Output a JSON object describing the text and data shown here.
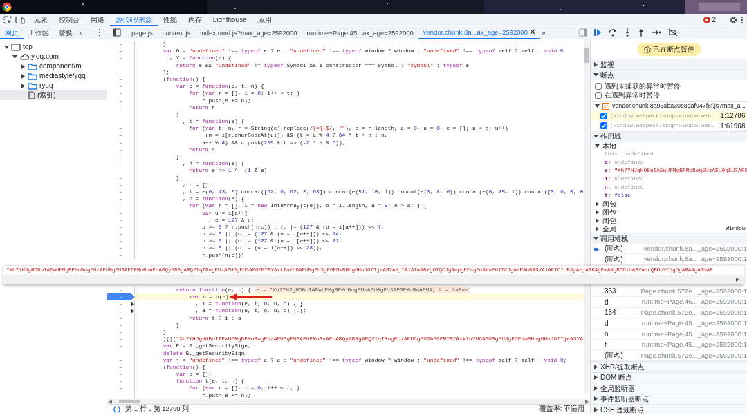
{
  "toolbar": {
    "tabs": [
      {
        "label": "元素",
        "selected": false
      },
      {
        "label": "控制台",
        "selected": false
      },
      {
        "label": "网络",
        "selected": false
      },
      {
        "label": "源代码/来源",
        "selected": true
      },
      {
        "label": "性能",
        "selected": false
      },
      {
        "label": "内存",
        "selected": false
      },
      {
        "label": "Lighthouse",
        "selected": false
      },
      {
        "label": "应用",
        "selected": false
      }
    ],
    "error_count": "2"
  },
  "navigator": {
    "tabs": [
      {
        "label": "网页",
        "selected": true
      },
      {
        "label": "工作区",
        "selected": false
      },
      {
        "label": "替换",
        "selected": false
      }
    ],
    "more": "»",
    "tree": [
      {
        "label": "top",
        "kind": "frame",
        "expanded": true,
        "selected": false,
        "children": [
          {
            "label": "y.qq.com",
            "kind": "domain",
            "expanded": true,
            "selected": false,
            "children": [
              {
                "label": "component/m",
                "kind": "folder",
                "expanded": false,
                "selected": false
              },
              {
                "label": "mediastyle/yqq",
                "kind": "folder",
                "expanded": false,
                "selected": false
              },
              {
                "label": "ryqq",
                "kind": "folder",
                "expanded": false,
                "selected": false
              },
              {
                "label": "(索引)",
                "kind": "file",
                "selected": true
              }
            ]
          }
        ]
      }
    ]
  },
  "editor": {
    "tabs": [
      {
        "label": "page.js",
        "selected": false
      },
      {
        "label": "content.js",
        "selected": false
      },
      {
        "label": "index.umd.js?max_age=2592000",
        "selected": false
      },
      {
        "label": "runtime~Page.45...ax_age=2592000",
        "selected": false
      },
      {
        "label": "vendor.chunk.8a...ax_age=2592000",
        "selected": true
      }
    ],
    "more": "»",
    "upper_lines": [
      {
        "kind": "plain",
        "gutter": "-",
        "seg": [
          "        }"
        ]
      },
      {
        "kind": "plain",
        "gutter": "-",
        "seg": [
          {
            "kw": "        var"
          },
          " G = ",
          {
            "str": "\"undefined\""
          },
          " !== ",
          {
            "kw": "typeof"
          },
          " e ? e : ",
          {
            "str": "\"undefined\""
          },
          " !== ",
          {
            "kw": "typeof"
          },
          " window ? window : ",
          {
            "str": "\"undefined\""
          },
          " !== ",
          {
            "kw": "typeof"
          },
          " self ? self : ",
          {
            "kw": "void"
          },
          {
            "num": " 0"
          }
        ]
      },
      {
        "kind": "plain",
        "gutter": "-",
        "seg": [
          "          , Y = ",
          {
            "kw": "function"
          },
          "(e) {"
        ]
      },
      {
        "kind": "plain",
        "gutter": "-",
        "seg": [
          {
            "kw": "            return"
          },
          " e && ",
          {
            "str": "\"undefined\""
          },
          " != ",
          {
            "kw": "typeof"
          },
          " Symbol && e.constructor === Symbol ? ",
          {
            "str": "\"symbol\""
          },
          " : ",
          {
            "kw": "typeof"
          },
          " e"
        ]
      },
      {
        "kind": "plain",
        "gutter": "-",
        "seg": [
          "        };"
        ]
      },
      {
        "kind": "plain",
        "gutter": "-",
        "seg": [
          "        (",
          {
            "kw": "function"
          },
          "() {"
        ]
      },
      {
        "kind": "plain",
        "gutter": "-",
        "seg": [
          {
            "kw": "            var"
          },
          " e = ",
          {
            "kw": "function"
          },
          "(e, t, n) {"
        ]
      },
      {
        "kind": "plain",
        "gutter": "-",
        "seg": [
          {
            "kw": "                for"
          },
          " (",
          {
            "kw": "var"
          },
          " r = [], i = ",
          {
            "num": "0"
          },
          "; i++ < t; )"
        ]
      },
      {
        "kind": "plain",
        "gutter": "-",
        "seg": [
          "                    r.push(e += n);"
        ]
      },
      {
        "kind": "plain",
        "gutter": "-",
        "seg": [
          {
            "kw": "                return"
          },
          " r"
        ]
      },
      {
        "kind": "plain",
        "gutter": "-",
        "seg": [
          "            }"
        ]
      },
      {
        "kind": "plain",
        "gutter": "-",
        "seg": [
          "              , t = ",
          {
            "kw": "function"
          },
          "(e) {"
        ]
      },
      {
        "kind": "plain",
        "gutter": "-",
        "seg": [
          {
            "kw": "                for"
          },
          " (",
          {
            "kw": "var"
          },
          " t, n, r = String(e).replace(",
          {
            "str": "/[=]+$/"
          },
          ", ",
          {
            "str": "\"\""
          },
          "), o = r.length, a = ",
          {
            "num": "0"
          },
          ", u = ",
          {
            "num": "0"
          },
          ", c = []; u < o; u++)"
        ]
      },
      {
        "kind": "plain",
        "gutter": "-",
        "seg": [
          "                    ~(n = i[r.charCodeAt(u)]) && (t = a % ",
          {
            "num": "4"
          },
          " ? ",
          {
            "num": "64"
          },
          " * t + n : n,"
        ]
      },
      {
        "kind": "plain",
        "gutter": "-",
        "seg": [
          "                    a++ % ",
          {
            "num": "4"
          },
          ") && c.push(",
          {
            "num": "255"
          },
          " & t >> (-",
          {
            "num": "2"
          },
          " * a & ",
          {
            "num": "6"
          },
          "));"
        ]
      },
      {
        "kind": "plain",
        "gutter": "-",
        "seg": [
          {
            "kw": "                return"
          },
          " c"
        ]
      },
      {
        "kind": "plain",
        "gutter": "-",
        "seg": [
          "            }"
        ]
      },
      {
        "kind": "plain",
        "gutter": "-",
        "seg": [
          "              , n = ",
          {
            "kw": "function"
          },
          "(e) {"
        ]
      },
      {
        "kind": "plain",
        "gutter": "-",
        "seg": [
          {
            "kw": "                return"
          },
          " e >> ",
          {
            "num": "1"
          },
          " ^ -(",
          {
            "num": "1"
          },
          " & e)"
        ]
      },
      {
        "kind": "plain",
        "gutter": "-",
        "seg": [
          "            }"
        ]
      },
      {
        "kind": "plain",
        "gutter": "-",
        "seg": [
          "              , r = []"
        ]
      },
      {
        "kind": "plain",
        "gutter": "-",
        "seg": [
          "              , i = e(",
          {
            "num": "0"
          },
          ", ",
          {
            "num": "43"
          },
          ", ",
          {
            "num": "0"
          },
          ").concat([",
          {
            "num": "62"
          },
          ", ",
          {
            "num": "0"
          },
          ", ",
          {
            "num": "62"
          },
          ", ",
          {
            "num": "0"
          },
          ", ",
          {
            "num": "63"
          },
          "]).concat(e(",
          {
            "num": "51"
          },
          ", ",
          {
            "num": "10"
          },
          ", ",
          {
            "num": "1"
          },
          ")).concat(e(",
          {
            "num": "0"
          },
          ", ",
          {
            "num": "8"
          },
          ", ",
          {
            "num": "0"
          },
          ")).concat(e(",
          {
            "num": "0"
          },
          ", ",
          {
            "num": "25"
          },
          ", ",
          {
            "num": "1"
          },
          ")).concat([",
          {
            "num": "0"
          },
          ", ",
          {
            "num": "0"
          },
          ", ",
          {
            "num": "0"
          },
          ", ",
          {
            "num": "0"
          }
        ]
      },
      {
        "kind": "plain",
        "gutter": "-",
        "seg": [
          "              , o = ",
          {
            "kw": "function"
          },
          "(e) {"
        ]
      },
      {
        "kind": "plain",
        "gutter": "-",
        "seg": [
          {
            "kw": "                for"
          },
          " (",
          {
            "kw": "var"
          },
          " r = [], i = ",
          {
            "kw": "new"
          },
          " Int8Array(t(e)), o = i.length, a = ",
          {
            "num": "0"
          },
          "; o > a; ) {"
        ]
      },
      {
        "kind": "plain",
        "gutter": "-",
        "seg": [
          {
            "kw": "                    var"
          },
          " u = i[a++]"
        ]
      },
      {
        "kind": "plain",
        "gutter": "-",
        "seg": [
          "                      , c = ",
          {
            "num": "127"
          },
          " & u;"
        ]
      },
      {
        "kind": "plain",
        "gutter": "-",
        "seg": [
          "                    u >= ",
          {
            "num": "0"
          },
          " ? r.push(n(c)) : (c |= (",
          {
            "num": "127"
          },
          " & (u = i[a++])) << ",
          {
            "num": "7"
          },
          ","
        ]
      },
      {
        "kind": "plain",
        "gutter": "-",
        "seg": [
          "                    u >= ",
          {
            "num": "0"
          },
          " || (c |= (",
          {
            "num": "127"
          },
          " & (u = i[a++])) << ",
          {
            "num": "14"
          },
          ","
        ]
      },
      {
        "kind": "plain",
        "gutter": "-",
        "seg": [
          "                    u >= ",
          {
            "num": "0"
          },
          " || (c |= (",
          {
            "num": "127"
          },
          " & (u = i[a++])) << ",
          {
            "num": "21"
          },
          ","
        ]
      },
      {
        "kind": "plain",
        "gutter": "-",
        "seg": [
          "                    u >= ",
          {
            "num": "0"
          },
          " || (c |= (u = i[a++]) << ",
          {
            "num": "28"
          },
          ")),"
        ]
      },
      {
        "kind": "plain",
        "gutter": "-",
        "seg": [
          "                    r.push(n(c)))"
        ]
      }
    ],
    "lower_lines": [
      {
        "kind": "plain",
        "gutter": "-",
        "seg": [
          {
            "kw": "            return"
          },
          {
            "kw": " function"
          },
          "(e, t) {"
        ],
        "inline_value": "e = \"Xh7YHJgHOBoIAEwUFMgBFMoBogEUzAEU0gEU3AFGFMoBnAEUA, t = false"
      },
      {
        "kind": "paused",
        "gutter": "-",
        "seg": [
          {
            "kw": "                var"
          },
          " n = o(e)"
        ]
      },
      {
        "kind": "folded",
        "gutter": "-",
        "seg": [
          "                  , i = ",
          {
            "kw": "function"
          },
          "(e, t, o, u, c) {…}"
        ]
      },
      {
        "kind": "folded",
        "gutter": "-",
        "seg": [
          "                  , a = ",
          {
            "kw": "function"
          },
          "(e, t, o, u, c) {…};"
        ]
      },
      {
        "kind": "plain",
        "gutter": "-",
        "seg": [
          {
            "kw": "                return"
          },
          " t ? i : a"
        ]
      },
      {
        "kind": "plain",
        "gutter": "-",
        "seg": [
          "            }"
        ]
      },
      {
        "kind": "plain",
        "gutter": "-",
        "seg": [
          "        }"
        ]
      },
      {
        "kind": "plain",
        "gutter": "-",
        "seg": [
          "        )()(",
          {
            "str": "\"Xh7YHJgHOBoIAEwUFMgBFMoBogEUzAEU0gEU3AFGFMoBnAEUABQyGBSgARQ2IqIBogEUzAEU6gEU3AFGFMYBYAxkInYU6AEU0gEU3gFOFNwBHhgUHoJOfTjeASYA"
          }
        ]
      },
      {
        "kind": "plain",
        "gutter": "-",
        "seg": [
          {
            "kw": "        var"
          },
          " P = G._getSecuritySign;"
        ]
      },
      {
        "kind": "plain",
        "gutter": "-",
        "seg": [
          {
            "kw": "        delete"
          },
          " G._getSecuritySign;"
        ]
      },
      {
        "kind": "plain",
        "gutter": "-",
        "seg": [
          {
            "kw": "        var"
          },
          " j = ",
          {
            "str": "\"undefined\""
          },
          " !== ",
          {
            "kw": "typeof"
          },
          " e ? e : ",
          {
            "str": "\"undefined\""
          },
          " !== ",
          {
            "kw": "typeof"
          },
          " window ? window : ",
          {
            "str": "\"undefined\""
          },
          " !== ",
          {
            "kw": "typeof"
          },
          " self ? self : ",
          {
            "kw": "void"
          },
          {
            "num": " 0"
          },
          ";"
        ]
      },
      {
        "kind": "plain",
        "gutter": "-",
        "seg": [
          "        (",
          {
            "kw": "function"
          },
          "() {"
        ]
      },
      {
        "kind": "plain",
        "gutter": "-",
        "seg": [
          {
            "kw": "            var"
          },
          " e = [];"
        ]
      },
      {
        "kind": "plain",
        "gutter": "-",
        "seg": [
          {
            "kw": "            function"
          },
          " t(e, t, n) {"
        ]
      },
      {
        "kind": "plain",
        "gutter": "-",
        "seg": [
          {
            "kw": "                for"
          },
          " (",
          {
            "kw": "var"
          },
          " r = [], i = ",
          {
            "num": "0"
          },
          "; i++ < t; )"
        ]
      },
      {
        "kind": "plain",
        "gutter": "-",
        "seg": [
          "                    r.push(e += n);"
        ]
      }
    ],
    "tooltip": "\"Xh7YHJgHOBoIAEwUFMgBFMoBogEUzAEU0gEU3AFGFMoBnAEUABQyGBSgARQ2IqIBogEUzAEU6gEU3AFGFMYBYAxkInYU6AEU0gEU3gFOFNwBHhgUHoJOfTjeASYAHjIAiAImABYgOIQCJgAepgECsgEmAHoEOIICJgAeFAb0ASYA1AEIOIoBJgAejAIK4gEmANgBDDiUASYAHrQBDoYCJgDgARA4gAImAE"
  },
  "status_bar": {
    "position": "第 1 行，第 12790 列",
    "coverage": "覆盖率: 不适用"
  },
  "debugger": {
    "paused_message": "已在断点暂停",
    "watch": {
      "title": "监视",
      "expanded": false
    },
    "breakpoints": {
      "title": "断点",
      "expanded": true,
      "options": [
        {
          "label": "遇到未捕获的异常时暂停",
          "checked": false
        },
        {
          "label": "在遇到异常时暂停",
          "checked": false
        }
      ],
      "file": {
        "name": "vendor.chunk.8a93aba30e8daf947f8f.js?max_a...",
        "expanded": true
      },
      "items": [
        {
          "code": "(window.webpackJsonp=window.web…",
          "location": "1:12786",
          "checked": true,
          "selected": true
        },
        {
          "code": "(window.webpackJsonp=window.web…",
          "location": "1:61908",
          "checked": true,
          "selected": false
        }
      ]
    },
    "scope": {
      "title": "作用域",
      "expanded": true,
      "groups": [
        {
          "label": "本地",
          "expanded": true,
          "variables": [
            {
              "name": "this:",
              "value": "undefined",
              "kind": "undefined",
              "own": false
            },
            {
              "name": "a:",
              "value": "undefined",
              "kind": "undefined",
              "own": true
            },
            {
              "name": "e:",
              "value": "\"Xh7YHJgHOBoIAEwUFMgBFMoBogEUzAEU0gEU3AFG",
              "kind": "string",
              "own": true
            },
            {
              "name": "i:",
              "value": "undefined",
              "kind": "undefined",
              "own": true
            },
            {
              "name": "n:",
              "value": "undefined",
              "kind": "undefined",
              "own": true
            },
            {
              "name": "t:",
              "value": "false",
              "kind": "boolean",
              "own": true
            }
          ]
        },
        {
          "label": "闭包",
          "expanded": false
        },
        {
          "label": "闭包",
          "expanded": false
        },
        {
          "label": "闭包",
          "expanded": false
        },
        {
          "label": "全局",
          "expanded": false,
          "value": "Window"
        }
      ]
    },
    "call_stack": {
      "title": "调用堆栈",
      "expanded": true,
      "frames": [
        {
          "name": "(匿名)",
          "location": "vendor.chunk.8a..._age=2592000:1",
          "selected": true
        },
        {
          "name": "(匿名)",
          "location": "vendor.chunk.8a..._age=2592000:1",
          "selected": false
        },
        {
          "name": "363",
          "location": "Page.chunk.572e..._age=2592000:1",
          "selected": false
        },
        {
          "name": "d",
          "location": "runtime~Page.45..._age=2592000:1",
          "selected": false
        },
        {
          "name": "154",
          "location": "Page.chunk.572e..._age=2592000:1",
          "selected": false
        },
        {
          "name": "d",
          "location": "runtime~Page.45..._age=2592000:1",
          "selected": false
        },
        {
          "name": "a",
          "location": "runtime~Page.45..._age=2592000:1",
          "selected": false
        },
        {
          "name": "t",
          "location": "runtime~Page.45..._age=2592000:1",
          "selected": false
        },
        {
          "name": "(匿名)",
          "location": "Page.chunk.572e..._age=2592000:1",
          "selected": false
        }
      ]
    },
    "more_sections": [
      {
        "title": "XHR/提取断点",
        "expanded": false
      },
      {
        "title": "DOM 断点",
        "expanded": false
      },
      {
        "title": "全局监听器",
        "expanded": false
      },
      {
        "title": "事件监听器断点",
        "expanded": false
      },
      {
        "title": "CSP 违规断点",
        "expanded": false
      }
    ]
  }
}
